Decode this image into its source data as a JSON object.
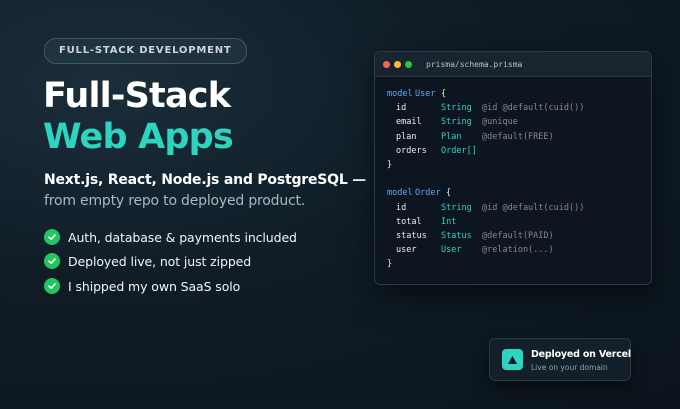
{
  "badge": "FULL-STACK DEVELOPMENT",
  "headline": {
    "line1": "Full-Stack",
    "line2": "Web Apps"
  },
  "subtitle": {
    "line1": "Next.js, React, Node.js and PostgreSQL —",
    "line2": "from empty repo to deployed product."
  },
  "features": [
    "Auth, database & payments included",
    "Deployed live, not just zipped",
    "I shipped my own SaaS solo"
  ],
  "editor": {
    "filename": "prisma/schema.prisma",
    "dots": [
      "#ff5f57",
      "#febc2e",
      "#28c840"
    ],
    "lines": [
      [
        "model",
        "User",
        "{",
        "",
        ""
      ],
      [
        "",
        "id",
        "String",
        "@id @default(cuid())",
        ""
      ],
      [
        "",
        "email",
        "String",
        "@unique",
        ""
      ],
      [
        "",
        "plan",
        "Plan",
        "@default(FREE)",
        ""
      ],
      [
        "",
        "orders",
        "Order[]",
        "",
        ""
      ],
      [
        "}",
        "",
        "",
        "",
        ""
      ],
      [
        "",
        "",
        "",
        "",
        ""
      ],
      [
        "model",
        "Order",
        "{",
        "",
        ""
      ],
      [
        "",
        "id",
        "String",
        "@id @default(cuid())",
        ""
      ],
      [
        "",
        "total",
        "Int",
        "",
        ""
      ],
      [
        "",
        "status",
        "Status",
        "@default(PAID)",
        ""
      ],
      [
        "",
        "user",
        "User",
        "@relation(...)",
        ""
      ],
      [
        "}",
        "",
        "",
        "",
        ""
      ]
    ]
  },
  "toast": {
    "title": "Deployed on Vercel",
    "subtitle": "Live on your domain",
    "icon": "triangle-icon"
  },
  "colors": {
    "accent": "#2dd4bf",
    "check": "#22c55e",
    "background": "#0f1c26",
    "keyword": "#5fa8f5",
    "comment": "#7b8a95"
  }
}
